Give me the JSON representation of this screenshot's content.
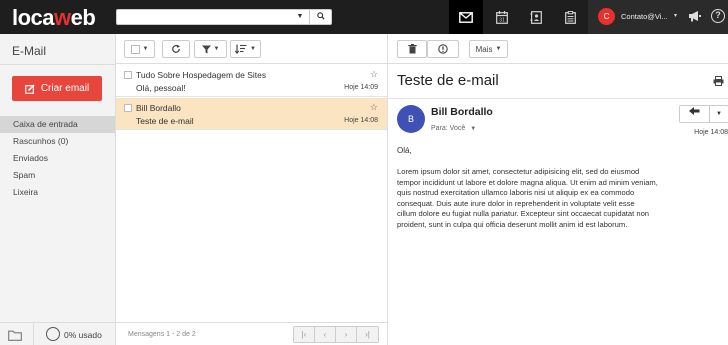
{
  "topbar": {
    "logo_left": "loca",
    "logo_accent": "w",
    "logo_right": "eb",
    "search": {
      "value": "",
      "placeholder": ""
    },
    "apps": [
      {
        "icon": "envelope-icon",
        "active": true
      },
      {
        "icon": "calendar-icon",
        "label": "31"
      },
      {
        "icon": "contacts-icon"
      },
      {
        "icon": "tasks-icon"
      }
    ],
    "user": {
      "initial": "C",
      "name": "Contato@Vi...",
      "caret": "▾"
    }
  },
  "sidebar": {
    "title": "E-Mail",
    "create_button": "Criar email",
    "folders": [
      {
        "label": "Caixa de entrada",
        "active": true
      },
      {
        "label": "Rascunhos  (0)"
      },
      {
        "label": "Enviados"
      },
      {
        "label": "Spam"
      },
      {
        "label": "Lixeira"
      }
    ],
    "usage": "0% usado"
  },
  "list": {
    "messages": [
      {
        "sender": "Tudo Sobre Hospedagem de Sites",
        "subject": "Olá, pessoal!",
        "date": "Hoje 14:09",
        "selected": false
      },
      {
        "sender": "Bill Bordallo",
        "subject": "Teste de e-mail",
        "date": "Hoje 14:08",
        "selected": true
      }
    ],
    "footer": "Mensagens 1 - 2 de 2"
  },
  "reader": {
    "more_button": "Mais",
    "title": "Teste de e-mail",
    "sender_initial": "B",
    "sender": "Bill Bordallo",
    "to_label": "Para: Você",
    "date": "Hoje 14:08",
    "greeting": "Olá,",
    "body_lines": [
      "Lorem ipsum dolor sit amet, consectetur adipisicing elit, sed do eiusmod",
      "tempor incididunt ut labore et dolore magna aliqua. Ut enim ad minim veniam,",
      "quis nostrud exercitation ullamco laboris nisi ut aliquip ex ea commodo",
      "consequat. Duis aute irure dolor in reprehenderit in voluptate velit esse",
      "cillum dolore eu fugiat nulla pariatur. Excepteur sint occaecat cupidatat non",
      "proident, sunt in culpa qui officia deserunt mollit anim id est laborum."
    ]
  },
  "colors": {
    "brand_red": "#e8312f",
    "create_button": "#e8463d",
    "selected_row": "#fbe4c1",
    "avatar_blue": "#3f51b5"
  }
}
